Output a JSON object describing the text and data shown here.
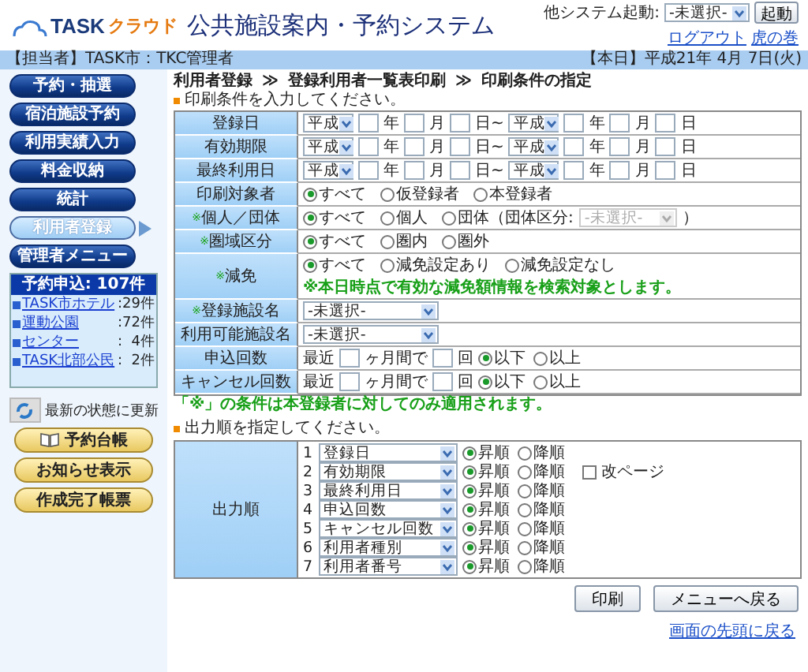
{
  "header": {
    "logo": {
      "primary": "TASK",
      "secondary": "クラウド"
    },
    "title": "公共施設案内・予約システム",
    "launcher": {
      "label": "他システム起動:",
      "value": "-未選択-",
      "button": "起動"
    },
    "links": [
      "ログアウト",
      "虎の巻"
    ]
  },
  "info_bar": {
    "user": "【担当者】TASK市：TKC管理者",
    "date": "【本日】平成21年 4月 7日(火)"
  },
  "sidebar": {
    "nav": [
      {
        "label": "予約・抽選",
        "selected": false
      },
      {
        "label": "宿泊施設予約",
        "selected": false
      },
      {
        "label": "利用実績入力",
        "selected": false
      },
      {
        "label": "料金収納",
        "selected": false
      },
      {
        "label": "統計",
        "selected": false
      },
      {
        "label": "利用者登録",
        "selected": true
      },
      {
        "label": "管理者メニュー",
        "selected": false
      }
    ],
    "summary": {
      "title": "予約申込: 107件",
      "items": [
        {
          "name": "TASK市ホテル",
          "count": ":29件"
        },
        {
          "name": "運動公園",
          "count": ":72件"
        },
        {
          "name": "センター",
          "count": ":  4件"
        },
        {
          "name": "TASK北部公民",
          "count": ":  2件"
        }
      ]
    },
    "refresh": "最新の状態に更新",
    "actions": [
      {
        "label": "予約台帳",
        "kind": "book"
      },
      {
        "label": "お知らせ表示",
        "kind": "plain"
      },
      {
        "label": "作成完了帳票",
        "kind": "plain"
      }
    ]
  },
  "breadcrumb": {
    "separator": "≫",
    "items": [
      "利用者登録",
      "登録利用者一覧表印刷",
      "印刷条件の指定"
    ]
  },
  "conditions": {
    "heading": "印刷条件を入力してください。",
    "rows": [
      {
        "kind": "date",
        "label": "登録日",
        "from": {
          "era": "平成",
          "units": [
            "年",
            "月",
            "日~"
          ]
        },
        "to": {
          "era": "平成",
          "units": [
            "年",
            "月",
            "日"
          ]
        }
      },
      {
        "kind": "date",
        "label": "有効期限",
        "from": {
          "era": "平成",
          "units": [
            "年",
            "月",
            "日~"
          ]
        },
        "to": {
          "era": "平成",
          "units": [
            "年",
            "月",
            "日"
          ]
        }
      },
      {
        "kind": "date",
        "label": "最終利用日",
        "from": {
          "era": "平成",
          "units": [
            "年",
            "月",
            "日~"
          ]
        },
        "to": {
          "era": "平成",
          "units": [
            "年",
            "月",
            "日"
          ]
        }
      },
      {
        "kind": "radio",
        "label": "印刷対象者",
        "options": [
          {
            "label": "すべて",
            "selected": true
          },
          {
            "label": "仮登録者",
            "selected": false
          },
          {
            "label": "本登録者",
            "selected": false
          }
        ]
      },
      {
        "kind": "radio",
        "mark": "※",
        "label": "個人／団体",
        "options": [
          {
            "label": "すべて",
            "selected": true
          },
          {
            "label": "個人",
            "selected": false
          },
          {
            "label": "団体（団体区分:",
            "selected": false,
            "group_select": {
              "value": "-未選択-",
              "disabled": true,
              "suffix": "）"
            }
          }
        ]
      },
      {
        "kind": "radio",
        "mark": "※",
        "label": "圏域区分",
        "options": [
          {
            "label": "すべて",
            "selected": true
          },
          {
            "label": "圏内",
            "selected": false
          },
          {
            "label": "圏外",
            "selected": false
          }
        ]
      },
      {
        "kind": "radio",
        "mark": "※",
        "label": "減免",
        "options": [
          {
            "label": "すべて",
            "selected": true
          },
          {
            "label": "減免設定あり",
            "selected": false
          },
          {
            "label": "減免設定なし",
            "selected": false
          }
        ],
        "note": "※本日時点で有効な減免額情報を検索対象とします。"
      },
      {
        "kind": "select",
        "mark": "※",
        "label": "登録施設名",
        "value": "-未選択-"
      },
      {
        "kind": "select",
        "label": "利用可能施設名",
        "value": "-未選択-"
      },
      {
        "kind": "count",
        "label": "申込回数",
        "prefix": "最近",
        "middle": "ヶ月間で",
        "unit": "回",
        "options": [
          {
            "label": "以下",
            "selected": true
          },
          {
            "label": "以上",
            "selected": false
          }
        ]
      },
      {
        "kind": "count",
        "label": "キャンセル回数",
        "prefix": "最近",
        "middle": "ヶ月間で",
        "unit": "回",
        "options": [
          {
            "label": "以下",
            "selected": true
          },
          {
            "label": "以上",
            "selected": false
          }
        ]
      }
    ],
    "footnote": "「※」の条件は本登録者に対してのみ適用されます。"
  },
  "output": {
    "heading": "出力順を指定してください。",
    "label": "出力順",
    "rows": [
      {
        "number": "1",
        "field": "登録日",
        "options": [
          {
            "label": "昇順",
            "selected": true
          },
          {
            "label": "降順",
            "selected": false
          }
        ]
      },
      {
        "number": "2",
        "field": "有効期限",
        "options": [
          {
            "label": "昇順",
            "selected": true
          },
          {
            "label": "降順",
            "selected": false
          }
        ],
        "page_break": {
          "label": "改ページ",
          "checked": false
        }
      },
      {
        "number": "3",
        "field": "最終利用日",
        "options": [
          {
            "label": "昇順",
            "selected": true
          },
          {
            "label": "降順",
            "selected": false
          }
        ]
      },
      {
        "number": "4",
        "field": "申込回数",
        "options": [
          {
            "label": "昇順",
            "selected": true
          },
          {
            "label": "降順",
            "selected": false
          }
        ]
      },
      {
        "number": "5",
        "field": "キャンセル回数",
        "options": [
          {
            "label": "昇順",
            "selected": true
          },
          {
            "label": "降順",
            "selected": false
          }
        ]
      },
      {
        "number": "6",
        "field": "利用者種別",
        "options": [
          {
            "label": "昇順",
            "selected": true
          },
          {
            "label": "降順",
            "selected": false
          }
        ]
      },
      {
        "number": "7",
        "field": "利用者番号",
        "options": [
          {
            "label": "昇順",
            "selected": true
          },
          {
            "label": "降順",
            "selected": false
          }
        ]
      }
    ]
  },
  "buttons": [
    "印刷",
    "メニューへ戻る"
  ],
  "top_link": "画面の先頭に戻る"
}
